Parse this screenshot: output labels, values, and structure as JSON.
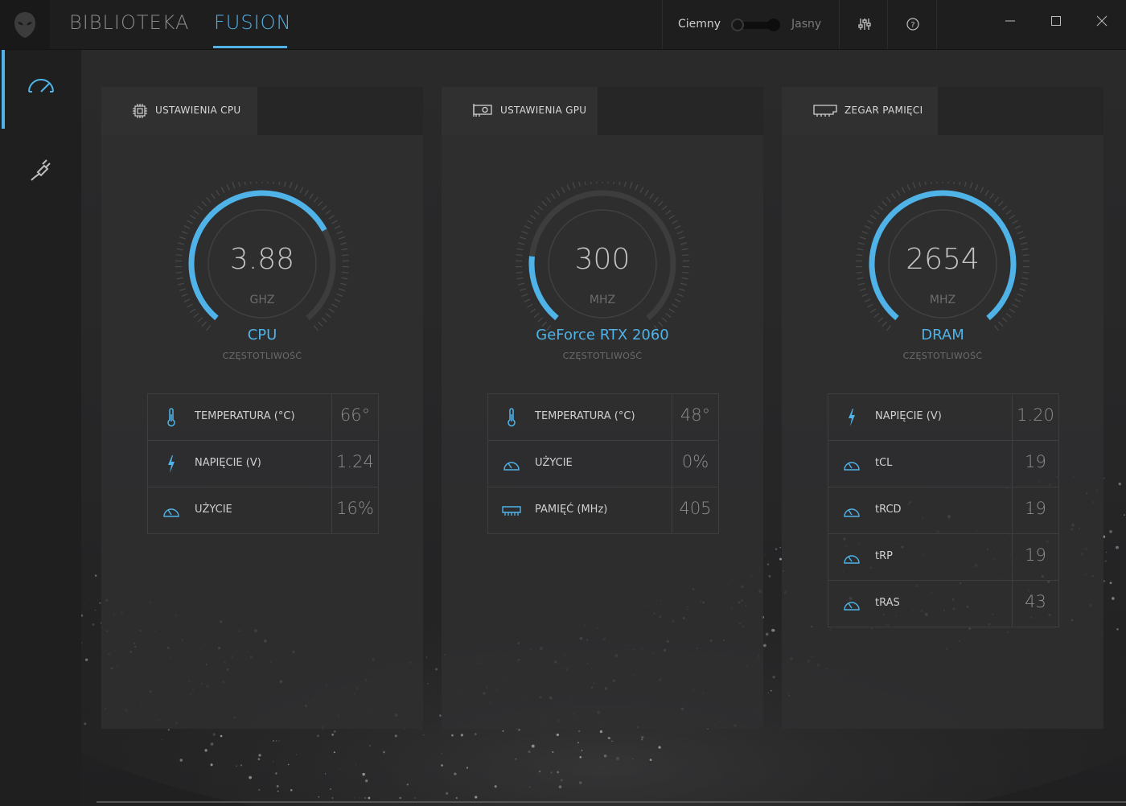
{
  "app": {
    "nav": {
      "library": "BIBLIOTEKA",
      "fusion": "FUSION"
    },
    "theme": {
      "dark": "Ciemny",
      "light": "Jasny"
    },
    "icons": {
      "logo": "alienware-logo-icon",
      "settings": "sliders-icon",
      "help": "help-icon",
      "minimize": "minimize-icon",
      "maximize": "maximize-icon",
      "close": "close-icon"
    },
    "sidebar": [
      {
        "icon": "speedometer-icon",
        "active": true
      },
      {
        "icon": "plug-icon",
        "active": false
      }
    ],
    "accent_color": "#4fb3e8"
  },
  "panels": {
    "cpu": {
      "title": "USTAWIENIA CPU",
      "title_icon": "cpu-chip-icon",
      "gauge": {
        "value": "3.88",
        "unit": "GHZ",
        "fill_fraction": 0.72
      },
      "device": "CPU",
      "subtitle": "CZĘSTOTLIWOŚĆ",
      "stats": [
        {
          "icon": "thermometer-icon",
          "label": "TEMPERATURA (°C)",
          "value": "66°"
        },
        {
          "icon": "lightning-icon",
          "label": "NAPIĘCIE (V)",
          "value": "1.24"
        },
        {
          "icon": "gauge-icon",
          "label": "UŻYCIE",
          "value": "16%"
        }
      ]
    },
    "gpu": {
      "title": "USTAWIENIA GPU",
      "title_icon": "graphics-card-icon",
      "gauge": {
        "value": "300",
        "unit": "MHZ",
        "fill_fraction": 0.2
      },
      "device": "GeForce RTX 2060",
      "subtitle": "CZĘSTOTLIWOŚĆ",
      "stats": [
        {
          "icon": "thermometer-icon",
          "label": "TEMPERATURA (°C)",
          "value": "48°"
        },
        {
          "icon": "gauge-icon",
          "label": "UŻYCIE",
          "value": "0%"
        },
        {
          "icon": "memory-icon",
          "label": "PAMIĘĆ (MHz)",
          "value": "405"
        }
      ]
    },
    "ram": {
      "title": "ZEGAR PAMIĘCI",
      "title_icon": "memory-module-icon",
      "gauge": {
        "value": "2654",
        "unit": "MHZ",
        "fill_fraction": 1.0
      },
      "device": "DRAM",
      "subtitle": "CZĘSTOTLIWOŚĆ",
      "stats": [
        {
          "icon": "lightning-icon",
          "label": "NAPIĘCIE (V)",
          "value": "1.20"
        },
        {
          "icon": "gauge-icon",
          "label": "tCL",
          "value": "19"
        },
        {
          "icon": "gauge-icon",
          "label": "tRCD",
          "value": "19"
        },
        {
          "icon": "gauge-icon",
          "label": "tRP",
          "value": "19"
        },
        {
          "icon": "gauge-icon",
          "label": "tRAS",
          "value": "43"
        }
      ]
    }
  }
}
